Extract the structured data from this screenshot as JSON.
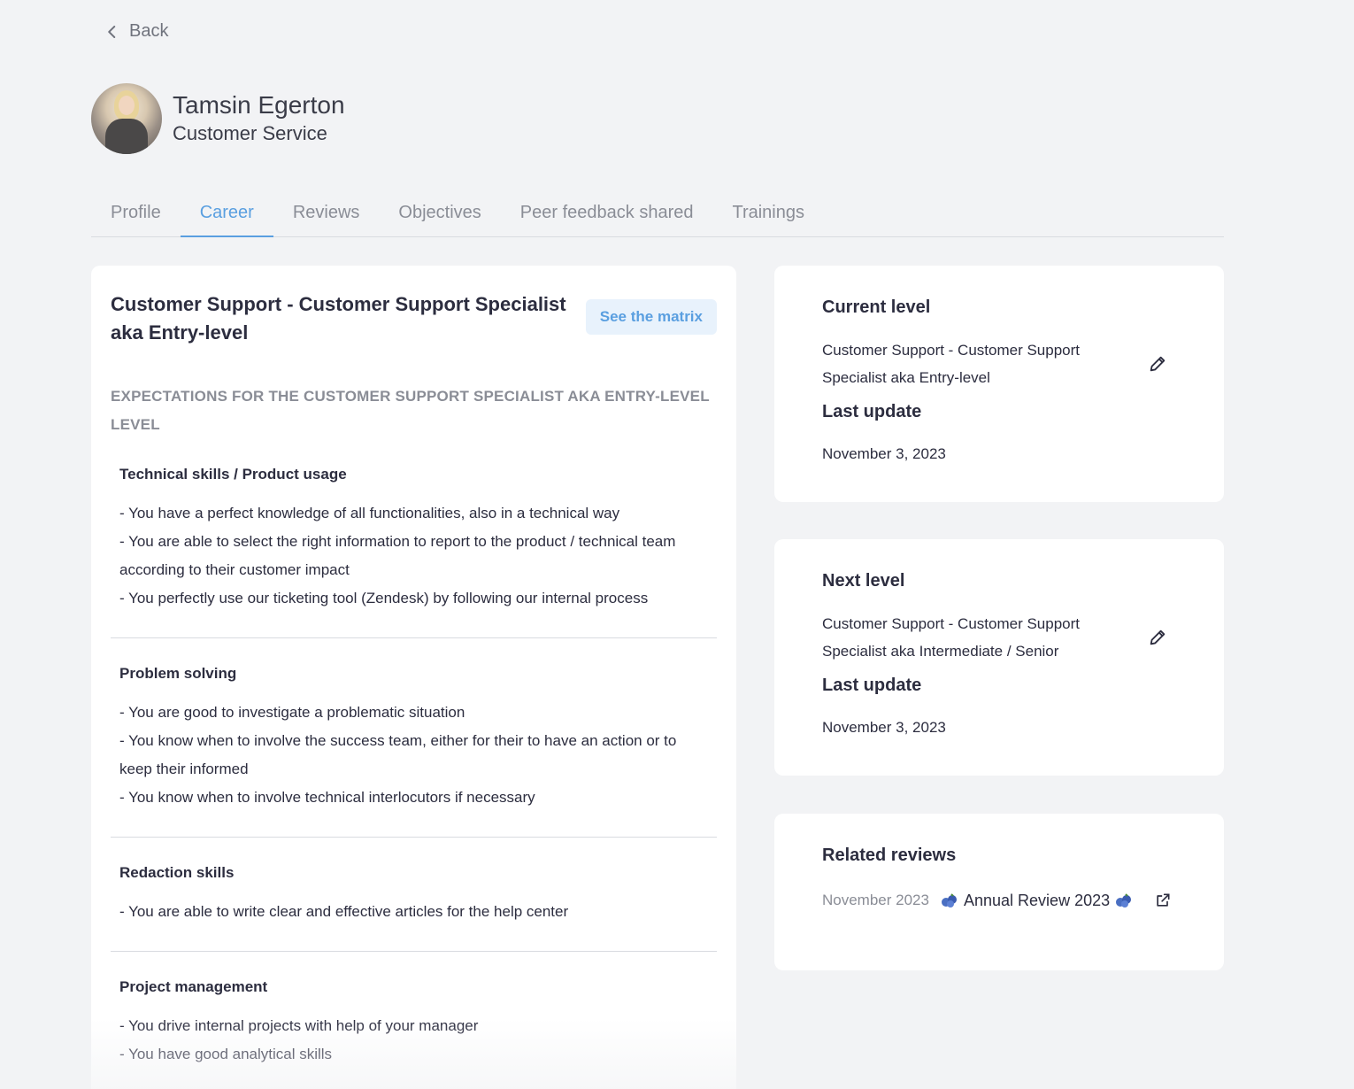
{
  "nav": {
    "back_label": "Back"
  },
  "employee": {
    "name": "Tamsin Egerton",
    "department": "Customer Service"
  },
  "tabs": [
    {
      "label": "Profile"
    },
    {
      "label": "Career"
    },
    {
      "label": "Reviews"
    },
    {
      "label": "Objectives"
    },
    {
      "label": "Peer feedback shared"
    },
    {
      "label": "Trainings"
    }
  ],
  "career": {
    "title": "Customer Support - Customer Support Specialist aka Entry-level",
    "matrix_button": "See the matrix",
    "expectations_heading": "EXPECTATIONS FOR THE CUSTOMER SUPPORT SPECIALIST AKA ENTRY-LEVEL LEVEL",
    "sections": [
      {
        "title": "Technical skills / Product usage",
        "lines": [
          "- You have a perfect knowledge of all functionalities, also in a technical way",
          "- You are able to select the right information to report to the product / technical team according to their customer impact",
          "- You perfectly use our ticketing tool (Zendesk) by following our internal process"
        ]
      },
      {
        "title": "Problem solving",
        "lines": [
          "- You are good to investigate a problematic situation",
          "- You know when to involve the success team, either for their to have an action or to keep their informed",
          "- You know when to involve technical interlocutors if necessary"
        ]
      },
      {
        "title": "Redaction skills",
        "lines": [
          "- You are able to write clear and effective articles for the help center"
        ]
      },
      {
        "title": "Project management",
        "lines": [
          "- You drive internal projects with help of your manager",
          "- You have good analytical skills"
        ]
      }
    ]
  },
  "current_level": {
    "title": "Current level",
    "value": "Customer Support - Customer Support Specialist aka Entry-level",
    "last_update_label": "Last update",
    "last_update_date": "November 3, 2023"
  },
  "next_level": {
    "title": "Next level",
    "value": "Customer Support - Customer Support Specialist aka Intermediate / Senior",
    "last_update_label": "Last update",
    "last_update_date": "November 3, 2023"
  },
  "related_reviews": {
    "title": "Related reviews",
    "items": [
      {
        "date": "November 2023",
        "name": "Annual Review 2023"
      }
    ]
  },
  "colors": {
    "accent": "#5a9fe0",
    "background": "#f2f3f5",
    "text": "#2c2d3f",
    "muted": "#8a8d96"
  }
}
